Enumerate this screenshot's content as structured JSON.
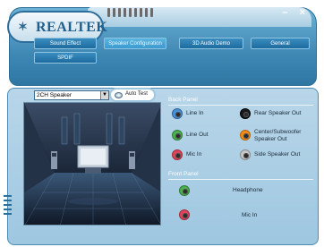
{
  "app": {
    "brand": "REALTEK",
    "window_controls": "– ×"
  },
  "tabs": [
    {
      "label": "Sound Effect",
      "active": false
    },
    {
      "label": "Speaker Configuration",
      "active": true
    },
    {
      "label": "3D Audio Demo",
      "active": false
    },
    {
      "label": "General",
      "active": false
    },
    {
      "label": "SPDIF",
      "active": false
    }
  ],
  "speaker_select": {
    "value": "2CH Speaker"
  },
  "auto_test": {
    "label": "Auto Test"
  },
  "back_panel": {
    "title": "Back Panel",
    "jacks": [
      {
        "label": "Line In",
        "color": "#4a90d9"
      },
      {
        "label": "Rear Speaker Out",
        "color": "#1a1a1a"
      },
      {
        "label": "Line Out",
        "color": "#4caf50"
      },
      {
        "label": "Center/Subwoofer Speaker Out",
        "color": "#f08c1a"
      },
      {
        "label": "Mic In",
        "color": "#e0445a"
      },
      {
        "label": "Side Speaker Out",
        "color": "#c7c7c7"
      }
    ]
  },
  "front_panel": {
    "title": "Front Panel",
    "jacks": [
      {
        "label": "Headphone",
        "color": "#4caf50"
      },
      {
        "label": "Mic In",
        "color": "#e0445a"
      }
    ]
  }
}
